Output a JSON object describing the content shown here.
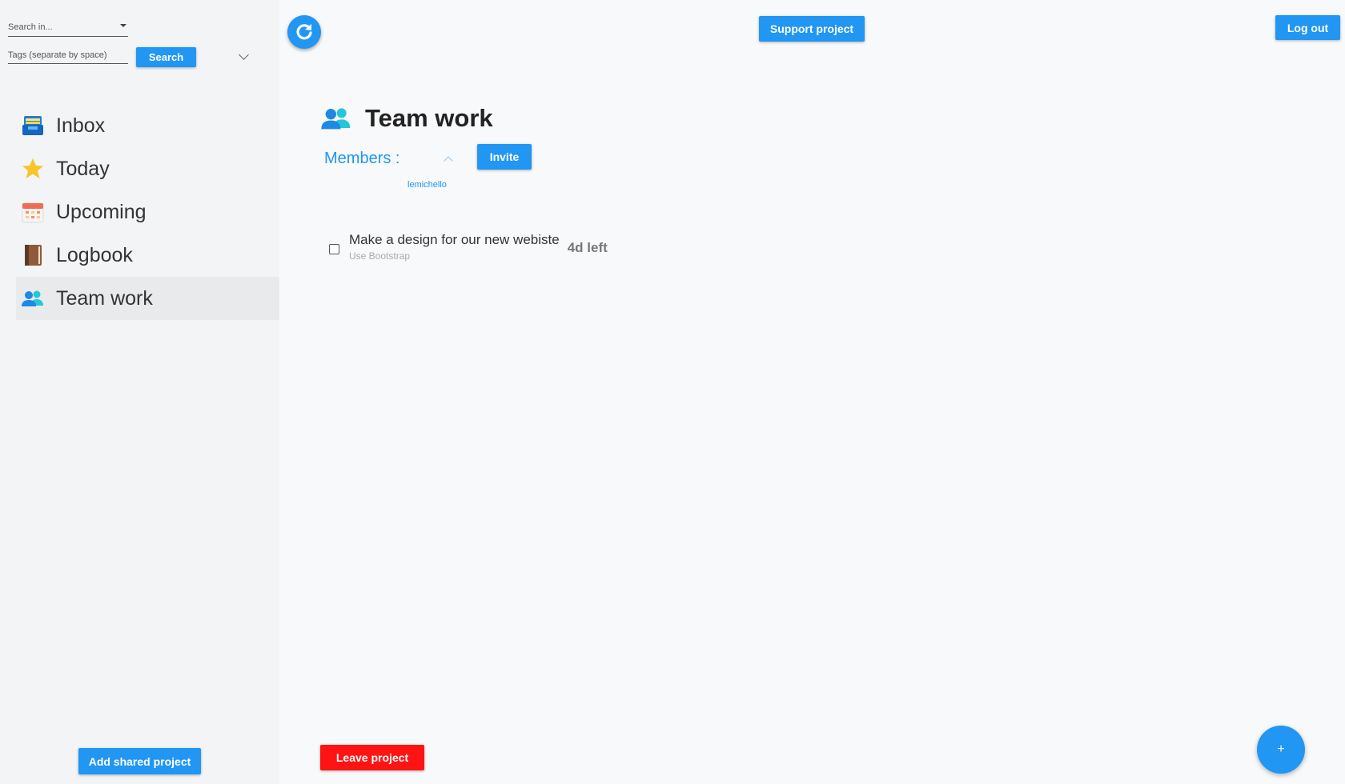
{
  "sidebar": {
    "search": {
      "scope_placeholder": "Search in...",
      "tags_placeholder": "Tags (separate by space)",
      "search_button": "Search"
    },
    "nav": {
      "inbox": "Inbox",
      "today": "Today",
      "upcoming": "Upcoming",
      "logbook": "Logbook",
      "team_work": "Team work"
    },
    "add_shared_project": "Add shared project"
  },
  "header": {
    "support_project": "Support project",
    "log_out": "Log out"
  },
  "project": {
    "title": "Team work",
    "members_label": "Members :",
    "invite_button": "Invite",
    "members": [
      "lemichello"
    ],
    "tasks": [
      {
        "title": "Make a design for our new webiste",
        "note": "Use Bootstrap",
        "due": "4d left"
      }
    ],
    "leave_button": "Leave project"
  },
  "fab_label": "+",
  "colors": {
    "accent": "#2196f3",
    "danger": "#ff1414",
    "sidebar_bg": "#f3f4f6",
    "active_item_bg": "#e9eaec"
  }
}
